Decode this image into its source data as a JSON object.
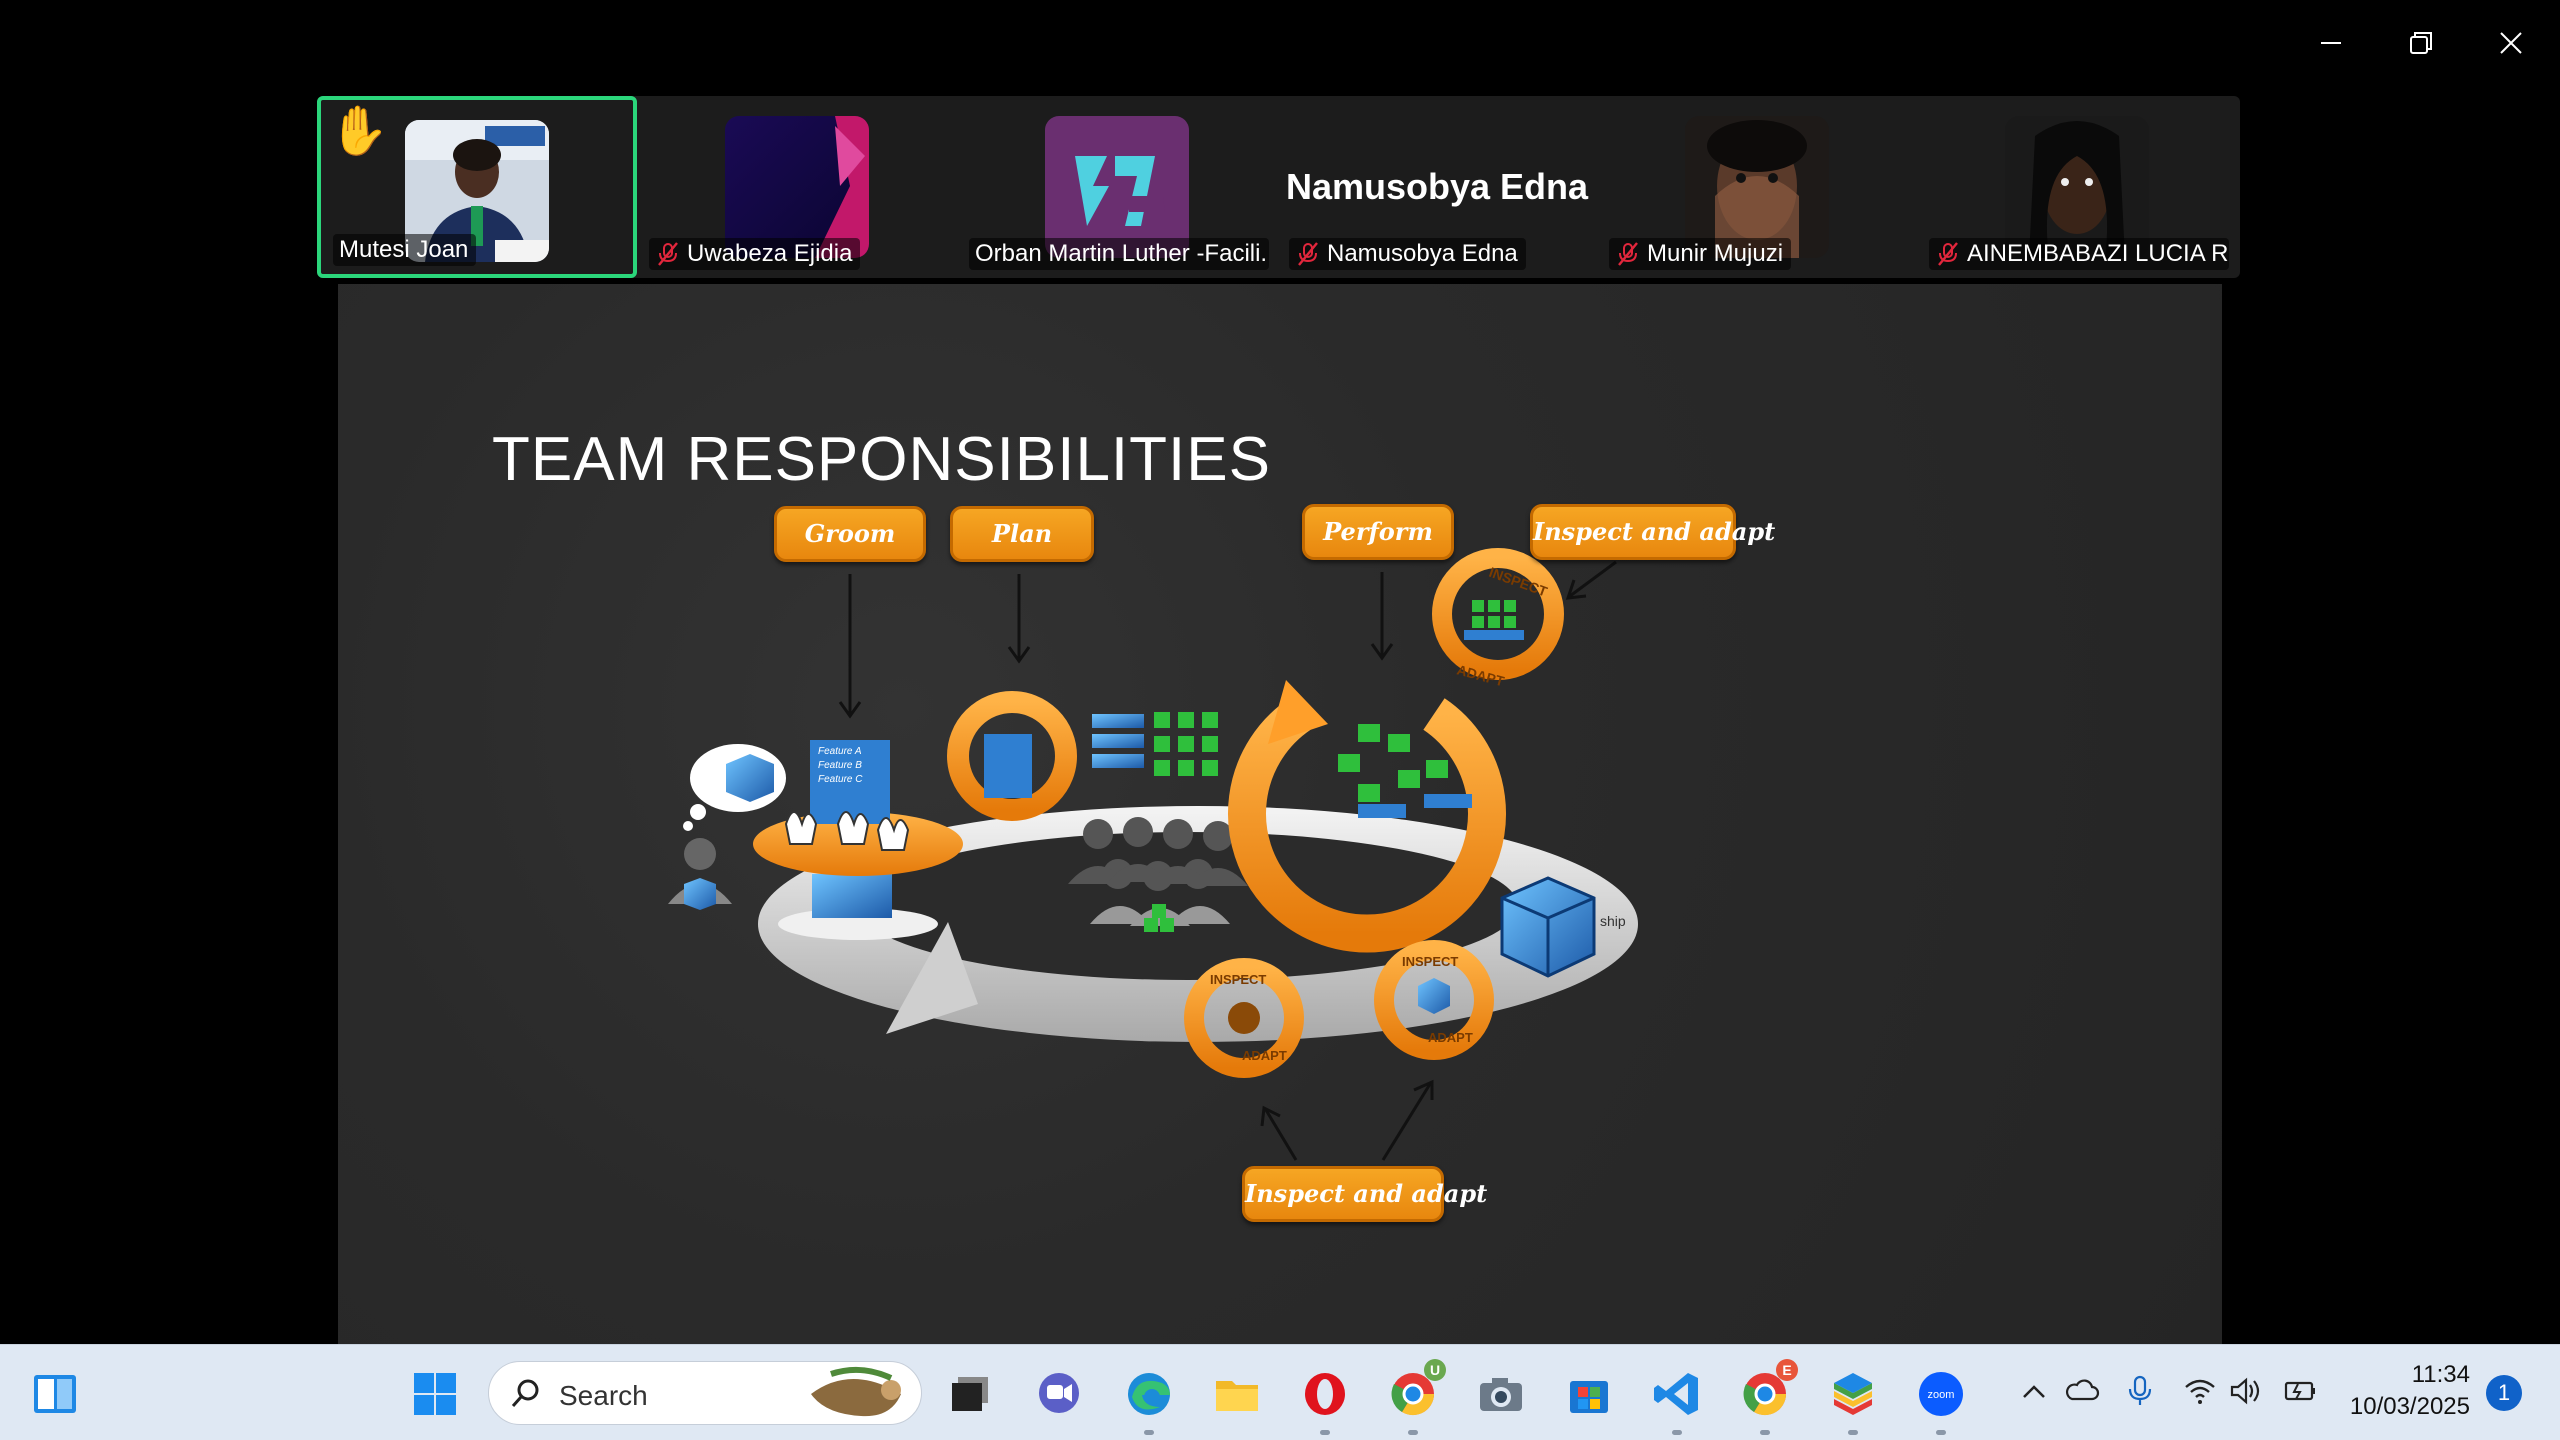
{
  "window": {
    "minimize_icon": "minimize-icon",
    "restore_icon": "restore-icon",
    "close_icon": "close-icon"
  },
  "participants": [
    {
      "name": "Mutesi Joan",
      "muted": false,
      "hand_raised": true,
      "active_speaker": true
    },
    {
      "name": "Uwabeza Ejidia",
      "muted": true
    },
    {
      "name": "Orban Martin Luther -Facili...",
      "muted": false
    },
    {
      "name": "Namusobya Edna",
      "muted": true,
      "display_name_large": "Namusobya Edna"
    },
    {
      "name": "Munir Mujuzi",
      "muted": true
    },
    {
      "name": "AINEMBABAZI LUCIA R...",
      "muted": true
    }
  ],
  "slide": {
    "title": "TEAM RESPONSIBILITIES",
    "tags": {
      "groom": "Groom",
      "plan": "Plan",
      "perform": "Perform",
      "inspect_top": "Inspect and adapt",
      "inspect_bottom": "Inspect and adapt"
    },
    "diagram_labels": {
      "inspect": "INSPECT",
      "adapt": "ADAPT",
      "feature_a": "Feature A",
      "feature_b": "Feature B",
      "feature_c": "Feature C",
      "ship": "ship"
    }
  },
  "taskbar": {
    "search_placeholder": "Search",
    "chrome_badge_1": "U",
    "chrome_badge_2": "E",
    "time": "11:34",
    "date": "10/03/2025",
    "notification_count": "1"
  },
  "colors": {
    "active_border": "#2bd67b",
    "tag_orange": "#f0961a",
    "taskbar_bg": "#dfe8f3"
  }
}
